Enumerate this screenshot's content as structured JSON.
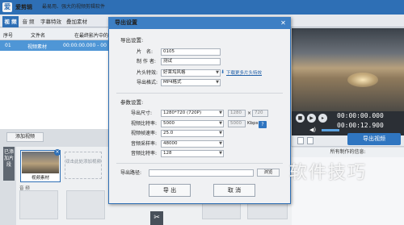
{
  "app": {
    "logo_text": "爱",
    "title": "爱剪辑",
    "slogan": "最易用、强大的视频剪辑软件"
  },
  "tabs": [
    {
      "label": "视 频"
    },
    {
      "label": "音 频"
    },
    {
      "label": "字幕特效"
    },
    {
      "label": "叠加素材"
    }
  ],
  "file_list": {
    "col_index": "序号",
    "col_name": "文件名",
    "col_range": "在最终影片中的时",
    "rows": [
      {
        "index": "01",
        "name": "视频素材",
        "range": "00:00:00.000 - 00"
      }
    ]
  },
  "player": {
    "time_current": "00:00:00.000",
    "time_total": "00:00:12.900",
    "export_label": "导出视频",
    "info_header": "所有制作的信息:"
  },
  "timeline": {
    "add_video_label": "添加视频",
    "side_label": "已添加片段",
    "clip_label": "视频素材",
    "empty_slot_text": "双击此处添加视频",
    "audio_label": "音 频"
  },
  "dialog": {
    "title": "导出设置",
    "section_info": "导出设置:",
    "label_title": "片　名:",
    "value_title": "0105",
    "label_author": "制 作 者:",
    "value_author": "测试",
    "label_intro": "片头特效:",
    "value_intro": "好莱坞风格",
    "download_link": "下载更多片头特效",
    "label_format": "导出格式:",
    "value_format": "MP4格式",
    "section_params": "参数设置:",
    "label_size": "导出尺寸:",
    "value_size": "1280*720 (720P)",
    "value_width": "1280",
    "value_height": "720",
    "size_x": "×",
    "label_vbitrate": "视频比特率:",
    "value_vbitrate": "5000",
    "value_vbitrate2": "5000",
    "vbitrate_unit": "Kbps",
    "help_label": "?",
    "label_fps": "视频帧速率:",
    "value_fps": "25.0",
    "label_asample": "音频采样率:",
    "value_asample": "48000",
    "label_abitrate": "音频比特率:",
    "value_abitrate": "128",
    "label_path": "导出路径:",
    "value_path": "",
    "browse_label": "浏览",
    "export_button": "导 出",
    "cancel_button": "取 消"
  },
  "watermark": "软件技巧",
  "icons": {
    "close": "close-icon",
    "dropdown": "chevron-down-icon",
    "download": "download-icon",
    "scissors": "scissors-icon"
  },
  "colors": {
    "accent": "#2e6fb5",
    "selected_row": "#4f96d6"
  }
}
